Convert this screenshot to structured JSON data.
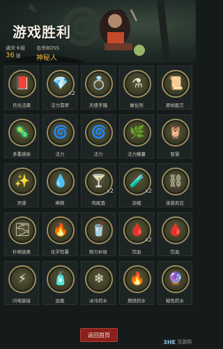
{
  "header": {
    "title": "游戏胜利",
    "stages_label": "通关卡组",
    "stages_value": "36",
    "stages_unit": "张",
    "boss_label": "击杀BOSS",
    "boss_value": "神秘人"
  },
  "items": [
    {
      "name": "月光法典",
      "qty": "",
      "icon": "book-icon",
      "glyph": "📕"
    },
    {
      "name": "法力翡翠",
      "qty": "x2",
      "icon": "emerald-icon",
      "glyph": "💎"
    },
    {
      "name": "天使手镯",
      "qty": "",
      "icon": "bracelet-icon",
      "glyph": "💍"
    },
    {
      "name": "催化剂",
      "qty": "",
      "icon": "catalyst-icon",
      "glyph": "⚗"
    },
    {
      "name": "原始配方",
      "qty": "",
      "icon": "scroll-icon",
      "glyph": "📜"
    },
    {
      "name": "多重感染",
      "qty": "",
      "icon": "infection-icon",
      "glyph": "🦠"
    },
    {
      "name": "法力",
      "qty": "",
      "icon": "mana-icon",
      "glyph": "🌀"
    },
    {
      "name": "法力",
      "qty": "",
      "icon": "mana-icon",
      "glyph": "🌀"
    },
    {
      "name": "法力藤蔓",
      "qty": "",
      "icon": "vine-icon",
      "glyph": "🌿"
    },
    {
      "name": "智慧",
      "qty": "",
      "icon": "wisdom-icon",
      "glyph": "🦉"
    },
    {
      "name": "灵感",
      "qty": "",
      "icon": "inspiration-icon",
      "glyph": "✨"
    },
    {
      "name": "稀释",
      "qty": "",
      "icon": "dilute-icon",
      "glyph": "💧"
    },
    {
      "name": "鸡尾酒",
      "qty": "x2",
      "icon": "cocktail-icon",
      "glyph": "🍸"
    },
    {
      "name": "浓缩",
      "qty": "x2",
      "icon": "concentrate-icon",
      "glyph": "🧪"
    },
    {
      "name": "连锁反应",
      "qty": "",
      "icon": "chain-reaction-icon",
      "glyph": "⛓"
    },
    {
      "name": "扑朔迷离",
      "qty": "",
      "icon": "mystery-icon",
      "glyph": "🌫"
    },
    {
      "name": "化学狂暴",
      "qty": "",
      "icon": "frenzy-icon",
      "glyph": "🔥"
    },
    {
      "name": "耐力补给",
      "qty": "",
      "icon": "stamina-icon",
      "glyph": "🥤"
    },
    {
      "name": "饮血",
      "qty": "x2",
      "icon": "blood-icon",
      "glyph": "🩸"
    },
    {
      "name": "饮血",
      "qty": "",
      "icon": "blood-icon",
      "glyph": "🩸"
    },
    {
      "name": "闪电链接",
      "qty": "",
      "icon": "lightning-icon",
      "glyph": "⚡"
    },
    {
      "name": "血瓶",
      "qty": "",
      "icon": "blood-vial-icon",
      "glyph": "🧴"
    },
    {
      "name": "冰冷药水",
      "qty": "",
      "icon": "ice-potion-icon",
      "glyph": "❄"
    },
    {
      "name": "燃烧药水",
      "qty": "",
      "icon": "fire-potion-icon",
      "glyph": "🔥"
    },
    {
      "name": "秘性药水",
      "qty": "",
      "icon": "secret-potion-icon",
      "glyph": "🔮"
    }
  ],
  "footer": {
    "return_label": "返回首页",
    "watermark_brand": "3HE",
    "watermark_text": "当游网"
  },
  "colors": {
    "accent_gold": "#f0b43a",
    "button_red": "#8a1f1c",
    "background": "#151a1a"
  }
}
